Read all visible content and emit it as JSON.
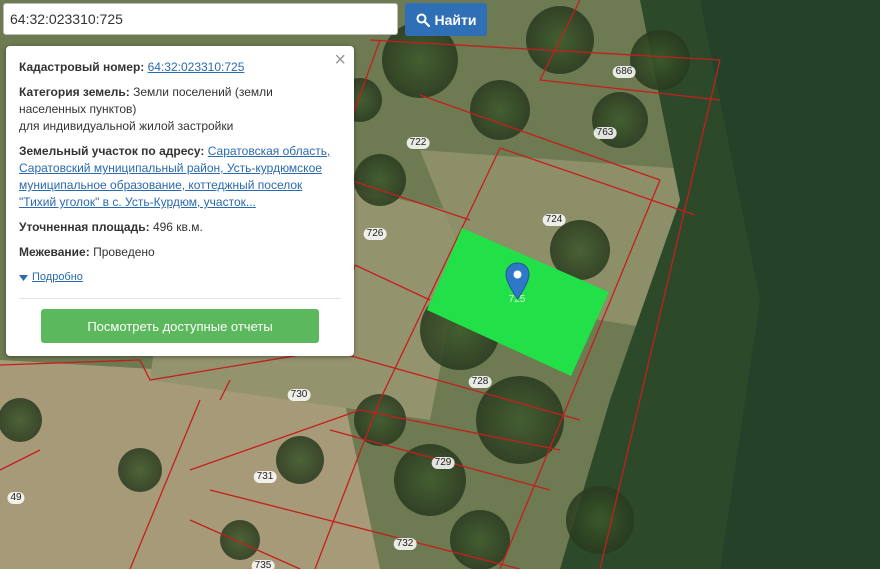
{
  "search": {
    "value": "64:32:023310:725",
    "button_label": "Найти"
  },
  "panel": {
    "cadastral_label": "Кадастровый номер:",
    "cadastral_number": "64:32:023310:725",
    "category_label": "Категория земель:",
    "category_value": "Земли поселений (земли населенных пунктов)",
    "usage": "для индивидуальной жилой застройки",
    "address_label": "Земельный участок по адресу:",
    "address_value": "Саратовская область, Саратовский муниципальный район, Усть-курдюмское муниципальное образование, коттеджный поселок \"Тихий уголок\" в с. Усть-Курдюм, участок...",
    "area_label": "Уточненная площадь:",
    "area_value": "496 кв.м.",
    "survey_label": "Межевание:",
    "survey_value": "Проведено",
    "details_link": "Подробно",
    "reports_button": "Посмотреть доступные отчеты"
  },
  "map": {
    "parcel_labels": [
      "686",
      "763",
      "722",
      "724",
      "726",
      "725",
      "728",
      "730",
      "729",
      "731",
      "732",
      "735",
      "49"
    ],
    "selected_parcel": "725",
    "colors": {
      "selected_fill": "#22e047",
      "boundary": "#c41f1f",
      "marker": "#2e78c7"
    }
  }
}
